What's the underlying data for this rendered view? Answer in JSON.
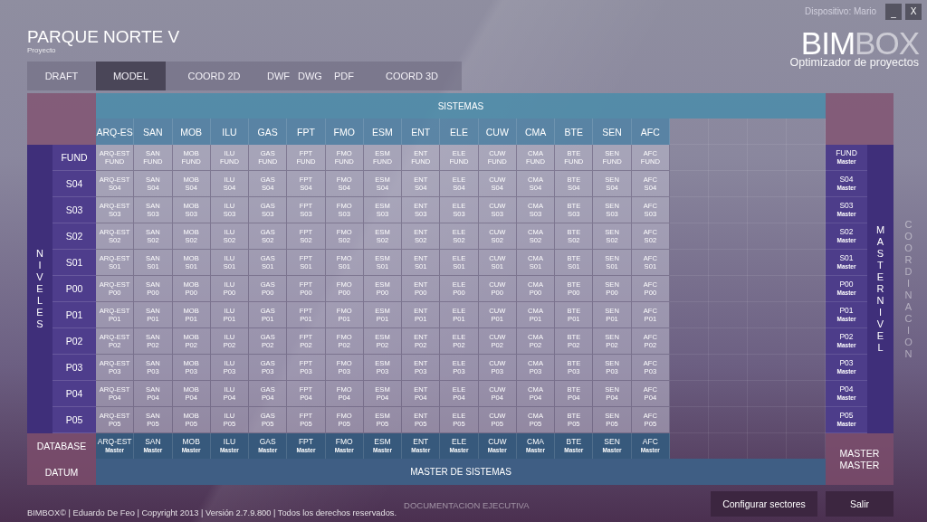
{
  "window": {
    "device": "Dispositivo: Mario",
    "controls": [
      {
        "kind": "minimize",
        "label": "_"
      },
      {
        "kind": "close",
        "label": "X"
      }
    ]
  },
  "project": {
    "title": "PARQUE NORTE V",
    "subtitle": "Proyecto"
  },
  "logo": {
    "strong": "BIM",
    "light": "BOX",
    "tagline": "Optimizador de proyectos"
  },
  "tabs": [
    {
      "label": "DRAFT",
      "selected": false
    },
    {
      "label": "MODEL",
      "selected": true
    },
    {
      "label": "COORD 2D",
      "selected": false
    },
    {
      "label": "DWF",
      "selected": false
    },
    {
      "label": "DWG",
      "selected": false
    },
    {
      "label": "PDF",
      "selected": false
    },
    {
      "label": "COORD 3D",
      "selected": false
    }
  ],
  "matrix": {
    "systems_title": "SISTEMAS",
    "levels_title": "NIVELES",
    "master_level_title": "MASTER NIVEL",
    "coordination_title": "COORDINACION",
    "systems": [
      "ARQ-ES",
      "SAN",
      "MOB",
      "ILU",
      "GAS",
      "FPT",
      "FMO",
      "ESM",
      "ENT",
      "ELE",
      "CUW",
      "CMA",
      "BTE",
      "SEN",
      "AFC"
    ],
    "rows": [
      {
        "level": "FUND",
        "cells": [
          [
            "ARQ-EST",
            "FUND"
          ],
          [
            "SAN",
            "FUND"
          ],
          [
            "MOB",
            "FUND"
          ],
          [
            "ILU",
            "FUND"
          ],
          [
            "GAS",
            "FUND"
          ],
          [
            "FPT",
            "FUND"
          ],
          [
            "FMO",
            "FUND"
          ],
          [
            "ESM",
            "FUND"
          ],
          [
            "ENT",
            "FUND"
          ],
          [
            "ELE",
            "FUND"
          ],
          [
            "CUW",
            "FUND"
          ],
          [
            "CMA",
            "FUND"
          ],
          [
            "BTE",
            "FUND"
          ],
          [
            "SEN",
            "FUND"
          ],
          [
            "AFC",
            "FUND"
          ]
        ],
        "master": [
          "FUND",
          "Master"
        ]
      },
      {
        "level": "S04",
        "cells": [
          [
            "ARQ-EST",
            "S04"
          ],
          [
            "SAN",
            "S04"
          ],
          [
            "MOB",
            "S04"
          ],
          [
            "ILU",
            "S04"
          ],
          [
            "GAS",
            "S04"
          ],
          [
            "FPT",
            "S04"
          ],
          [
            "FMO",
            "S04"
          ],
          [
            "ESM",
            "S04"
          ],
          [
            "ENT",
            "S04"
          ],
          [
            "ELE",
            "S04"
          ],
          [
            "CUW",
            "S04"
          ],
          [
            "CMA",
            "S04"
          ],
          [
            "BTE",
            "S04"
          ],
          [
            "SEN",
            "S04"
          ],
          [
            "AFC",
            "S04"
          ]
        ],
        "master": [
          "S04",
          "Master"
        ]
      },
      {
        "level": "S03",
        "cells": [
          [
            "ARQ-EST",
            "S03"
          ],
          [
            "SAN",
            "S03"
          ],
          [
            "MOB",
            "S03"
          ],
          [
            "ILU",
            "S03"
          ],
          [
            "GAS",
            "S03"
          ],
          [
            "FPT",
            "S03"
          ],
          [
            "FMO",
            "S03"
          ],
          [
            "ESM",
            "S03"
          ],
          [
            "ENT",
            "S03"
          ],
          [
            "ELE",
            "S03"
          ],
          [
            "CUW",
            "S03"
          ],
          [
            "CMA",
            "S03"
          ],
          [
            "BTE",
            "S03"
          ],
          [
            "SEN",
            "S03"
          ],
          [
            "AFC",
            "S03"
          ]
        ],
        "master": [
          "S03",
          "Master"
        ]
      },
      {
        "level": "S02",
        "cells": [
          [
            "ARQ-EST",
            "S02"
          ],
          [
            "SAN",
            "S02"
          ],
          [
            "MOB",
            "S02"
          ],
          [
            "ILU",
            "S02"
          ],
          [
            "GAS",
            "S02"
          ],
          [
            "FPT",
            "S02"
          ],
          [
            "FMO",
            "S02"
          ],
          [
            "ESM",
            "S02"
          ],
          [
            "ENT",
            "S02"
          ],
          [
            "ELE",
            "S02"
          ],
          [
            "CUW",
            "S02"
          ],
          [
            "CMA",
            "S02"
          ],
          [
            "BTE",
            "S02"
          ],
          [
            "SEN",
            "S02"
          ],
          [
            "AFC",
            "S02"
          ]
        ],
        "master": [
          "S02",
          "Master"
        ]
      },
      {
        "level": "S01",
        "cells": [
          [
            "ARQ-EST",
            "S01"
          ],
          [
            "SAN",
            "S01"
          ],
          [
            "MOB",
            "S01"
          ],
          [
            "ILU",
            "S01"
          ],
          [
            "GAS",
            "S01"
          ],
          [
            "FPT",
            "S01"
          ],
          [
            "FMO",
            "S01"
          ],
          [
            "ESM",
            "S01"
          ],
          [
            "ENT",
            "S01"
          ],
          [
            "ELE",
            "S01"
          ],
          [
            "CUW",
            "S01"
          ],
          [
            "CMA",
            "S01"
          ],
          [
            "BTE",
            "S01"
          ],
          [
            "SEN",
            "S01"
          ],
          [
            "AFC",
            "S01"
          ]
        ],
        "master": [
          "S01",
          "Master"
        ]
      },
      {
        "level": "P00",
        "cells": [
          [
            "ARQ-EST",
            "P00"
          ],
          [
            "SAN",
            "P00"
          ],
          [
            "MOB",
            "P00"
          ],
          [
            "ILU",
            "P00"
          ],
          [
            "GAS",
            "P00"
          ],
          [
            "FPT",
            "P00"
          ],
          [
            "FMO",
            "P00"
          ],
          [
            "ESM",
            "P00"
          ],
          [
            "ENT",
            "P00"
          ],
          [
            "ELE",
            "P00"
          ],
          [
            "CUW",
            "P00"
          ],
          [
            "CMA",
            "P00"
          ],
          [
            "BTE",
            "P00"
          ],
          [
            "SEN",
            "P00"
          ],
          [
            "AFC",
            "P00"
          ]
        ],
        "master": [
          "P00",
          "Master"
        ]
      },
      {
        "level": "P01",
        "cells": [
          [
            "ARQ-EST",
            "P01"
          ],
          [
            "SAN",
            "P01"
          ],
          [
            "MOB",
            "P01"
          ],
          [
            "ILU",
            "P01"
          ],
          [
            "GAS",
            "P01"
          ],
          [
            "FPT",
            "P01"
          ],
          [
            "FMO",
            "P01"
          ],
          [
            "ESM",
            "P01"
          ],
          [
            "ENT",
            "P01"
          ],
          [
            "ELE",
            "P01"
          ],
          [
            "CUW",
            "P01"
          ],
          [
            "CMA",
            "P01"
          ],
          [
            "BTE",
            "P01"
          ],
          [
            "SEN",
            "P01"
          ],
          [
            "AFC",
            "P01"
          ]
        ],
        "master": [
          "P01",
          "Master"
        ]
      },
      {
        "level": "P02",
        "cells": [
          [
            "ARQ-EST",
            "P02"
          ],
          [
            "SAN",
            "P02"
          ],
          [
            "MOB",
            "P02"
          ],
          [
            "ILU",
            "P02"
          ],
          [
            "GAS",
            "P02"
          ],
          [
            "FPT",
            "P02"
          ],
          [
            "FMO",
            "P02"
          ],
          [
            "ESM",
            "P02"
          ],
          [
            "ENT",
            "P02"
          ],
          [
            "ELE",
            "P02"
          ],
          [
            "CUW",
            "P02"
          ],
          [
            "CMA",
            "P02"
          ],
          [
            "BTE",
            "P02"
          ],
          [
            "SEN",
            "P02"
          ],
          [
            "AFC",
            "P02"
          ]
        ],
        "master": [
          "P02",
          "Master"
        ]
      },
      {
        "level": "P03",
        "cells": [
          [
            "ARQ-EST",
            "P03"
          ],
          [
            "SAN",
            "P03"
          ],
          [
            "MOB",
            "P03"
          ],
          [
            "ILU",
            "P03"
          ],
          [
            "GAS",
            "P03"
          ],
          [
            "FPT",
            "P03"
          ],
          [
            "FMO",
            "P03"
          ],
          [
            "ESM",
            "P03"
          ],
          [
            "ENT",
            "P03"
          ],
          [
            "ELE",
            "P03"
          ],
          [
            "CUW",
            "P03"
          ],
          [
            "CMA",
            "P03"
          ],
          [
            "BTE",
            "P03"
          ],
          [
            "SEN",
            "P03"
          ],
          [
            "AFC",
            "P03"
          ]
        ],
        "master": [
          "P03",
          "Master"
        ]
      },
      {
        "level": "P04",
        "cells": [
          [
            "ARQ-EST",
            "P04"
          ],
          [
            "SAN",
            "P04"
          ],
          [
            "MOB",
            "P04"
          ],
          [
            "ILU",
            "P04"
          ],
          [
            "GAS",
            "P04"
          ],
          [
            "FPT",
            "P04"
          ],
          [
            "FMO",
            "P04"
          ],
          [
            "ESM",
            "P04"
          ],
          [
            "ENT",
            "P04"
          ],
          [
            "ELE",
            "P04"
          ],
          [
            "CUW",
            "P04"
          ],
          [
            "CMA",
            "P04"
          ],
          [
            "BTE",
            "P04"
          ],
          [
            "SEN",
            "P04"
          ],
          [
            "AFC",
            "P04"
          ]
        ],
        "master": [
          "P04",
          "Master"
        ]
      },
      {
        "level": "P05",
        "cells": [
          [
            "ARQ-EST",
            "P05"
          ],
          [
            "SAN",
            "P05"
          ],
          [
            "MOB",
            "P05"
          ],
          [
            "ILU",
            "P05"
          ],
          [
            "GAS",
            "P05"
          ],
          [
            "FPT",
            "P05"
          ],
          [
            "FMO",
            "P05"
          ],
          [
            "ESM",
            "P05"
          ],
          [
            "ENT",
            "P05"
          ],
          [
            "ELE",
            "P05"
          ],
          [
            "CUW",
            "P05"
          ],
          [
            "CMA",
            "P05"
          ],
          [
            "BTE",
            "P05"
          ],
          [
            "SEN",
            "P05"
          ],
          [
            "AFC",
            "P05"
          ]
        ],
        "master": [
          "P05",
          "Master"
        ]
      }
    ],
    "database": {
      "label": "DATABASE",
      "cells": [
        [
          "ARQ-EST",
          "Master"
        ],
        [
          "SAN",
          "Master"
        ],
        [
          "MOB",
          "Master"
        ],
        [
          "ILU",
          "Master"
        ],
        [
          "GAS",
          "Master"
        ],
        [
          "FPT",
          "Master"
        ],
        [
          "FMO",
          "Master"
        ],
        [
          "ESM",
          "Master"
        ],
        [
          "ENT",
          "Master"
        ],
        [
          "ELE",
          "Master"
        ],
        [
          "CUW",
          "Master"
        ],
        [
          "CMA",
          "Master"
        ],
        [
          "BTE",
          "Master"
        ],
        [
          "SEN",
          "Master"
        ],
        [
          "AFC",
          "Master"
        ]
      ]
    },
    "datum": {
      "label": "DATUM",
      "master_systems": "MASTER DE SISTEMAS"
    },
    "master_master": [
      "MASTER",
      "MASTER"
    ]
  },
  "footer": {
    "copyright": "BIMBOX© |  Eduardo De Feo | Copyright 2013 | Versión 2.7.9.800 | Todos los derechos reservados.",
    "section": "DOCUMENTACION EJECUTIVA",
    "buttons": [
      {
        "kind": "configure",
        "label": "Configurar sectores"
      },
      {
        "kind": "exit",
        "label": "Salir"
      }
    ]
  }
}
